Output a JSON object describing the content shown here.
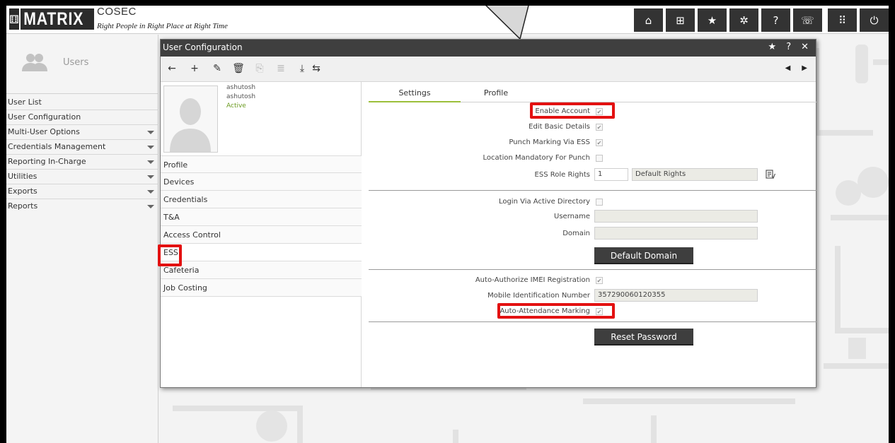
{
  "header": {
    "logo_mark": "⚅",
    "logo_text": "MATRIX",
    "product": "COSEC",
    "tagline": "Right People in Right Place at Right Time",
    "nav_icons": [
      "home-icon",
      "grid-icon",
      "star-icon",
      "gear-icon",
      "help-icon",
      "phone-icon",
      "apps-icon",
      "power-icon"
    ],
    "nav_glyphs": [
      "⌂",
      "⊞",
      "★",
      "✲",
      "?",
      "☏",
      "⠿",
      "⏻"
    ]
  },
  "sidebar": {
    "title": "Users",
    "items": [
      {
        "label": "User List",
        "has_submenu": false
      },
      {
        "label": "User Configuration",
        "has_submenu": false
      },
      {
        "label": "Multi-User Options",
        "has_submenu": true
      },
      {
        "label": "Credentials Management",
        "has_submenu": true
      },
      {
        "label": "Reporting In-Charge",
        "has_submenu": true
      },
      {
        "label": "Utilities",
        "has_submenu": true
      },
      {
        "label": "Exports",
        "has_submenu": true
      },
      {
        "label": "Reports",
        "has_submenu": true
      }
    ]
  },
  "dialog": {
    "title": "User Configuration",
    "title_icons": [
      "★",
      "?",
      "✕"
    ],
    "toolbar": {
      "back": "←",
      "add": "+",
      "edit": "✎",
      "delete": "🗑",
      "save": "⎘",
      "clear": "≣",
      "download": "⤓",
      "refresh": "⇆",
      "prev": "◀",
      "next": "▶"
    },
    "user": {
      "name": "ashutosh",
      "id": "ashutosh",
      "status": "Active"
    },
    "left_nav": [
      "Profile",
      "Devices",
      "Credentials",
      "T&A",
      "Access Control",
      "ESS",
      "Cafeteria",
      "Job Costing"
    ],
    "active_left_nav": "ESS",
    "tabs": [
      "Settings",
      "Profile"
    ],
    "active_tab": "Settings",
    "settings": {
      "enable_account": {
        "label": "Enable Account",
        "checked": true
      },
      "edit_basic_details": {
        "label": "Edit Basic Details",
        "checked": true
      },
      "punch_marking_ess": {
        "label": "Punch Marking Via ESS",
        "checked": true
      },
      "location_mandatory": {
        "label": "Location Mandatory For Punch",
        "checked": false
      },
      "ess_role_rights": {
        "label": "ESS Role Rights",
        "value": "1",
        "name": "Default Rights"
      },
      "login_active_directory": {
        "label": "Login Via Active Directory",
        "checked": false
      },
      "username": {
        "label": "Username",
        "value": ""
      },
      "domain": {
        "label": "Domain",
        "value": ""
      },
      "default_domain_btn": "Default Domain",
      "auto_authorize_imei": {
        "label": "Auto-Authorize IMEI Registration",
        "checked": true
      },
      "mobile_id_number": {
        "label": "Mobile Identification Number",
        "value": "357290060120355"
      },
      "auto_attendance": {
        "label": "Auto-Attendance Marking",
        "checked": true
      },
      "reset_password_btn": "Reset Password"
    }
  },
  "colors": {
    "highlight": "#e31111",
    "active_tab": "#9bbf3a",
    "status_active": "#6a9a1f"
  }
}
